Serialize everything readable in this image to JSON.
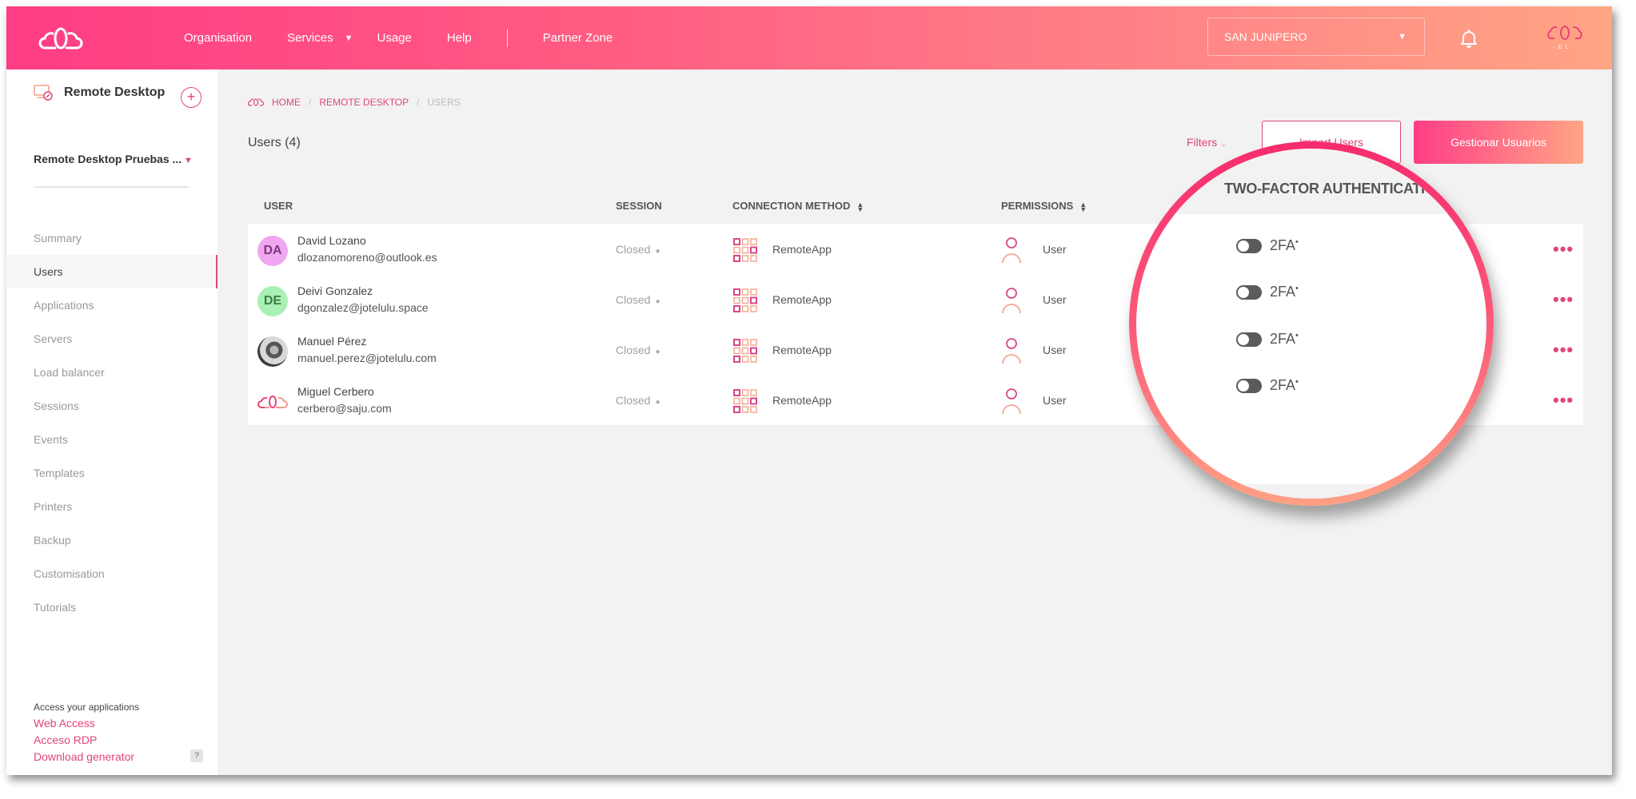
{
  "header": {
    "nav": {
      "organisation": "Organisation",
      "services": "Services",
      "usage": "Usage",
      "help": "Help",
      "partner_zone": "Partner Zone"
    },
    "org_selector": "SAN JUNIPERO",
    "icons": {
      "logo": "cloud-logo-icon",
      "bell": "bell-icon",
      "tenant_logo": "tenant-logo-icon"
    }
  },
  "sidebar": {
    "app_title": "Remote Desktop",
    "add_label": "+",
    "project": "Remote Desktop Pruebas ...",
    "menu": [
      {
        "label": "Summary",
        "active": false
      },
      {
        "label": "Users",
        "active": true
      },
      {
        "label": "Applications",
        "active": false
      },
      {
        "label": "Servers",
        "active": false
      },
      {
        "label": "Load balancer",
        "active": false
      },
      {
        "label": "Sessions",
        "active": false
      },
      {
        "label": "Events",
        "active": false
      },
      {
        "label": "Templates",
        "active": false
      },
      {
        "label": "Printers",
        "active": false
      },
      {
        "label": "Backup",
        "active": false
      },
      {
        "label": "Customisation",
        "active": false
      },
      {
        "label": "Tutorials",
        "active": false
      }
    ],
    "access": {
      "title": "Access your applications",
      "links": [
        "Web Access",
        "Acceso RDP",
        "Download generator"
      ],
      "help": "?"
    }
  },
  "breadcrumb": {
    "items": [
      "HOME",
      "REMOTE DESKTOP",
      "USERS"
    ],
    "separator": "/"
  },
  "toolbar": {
    "users_count": "Users (4)",
    "filters": "Filters",
    "filters_chevron": "⌄",
    "import_users": "Import Users",
    "manage_users": "Gestionar Usuarios"
  },
  "table": {
    "columns": {
      "user": "USER",
      "session": "SESSION",
      "connection_method": "CONNECTION METHOD",
      "permissions": "PERMISSIONS",
      "two_factor": "TWO-FACTOR AUTHENTICATION"
    },
    "sort_icon": "⬍",
    "rows": [
      {
        "initials": "DA",
        "avatar": "initials",
        "name": "David Lozano",
        "email": "dlozanomoreno@outlook.es",
        "session": "Closed",
        "connection": "RemoteApp",
        "permission": "User",
        "tfa_label": "2FA",
        "tfa_enabled": false,
        "more": "•••"
      },
      {
        "initials": "DE",
        "avatar": "initials",
        "name": "Deivi Gonzalez",
        "email": "dgonzalez@jotelulu.space",
        "session": "Closed",
        "connection": "RemoteApp",
        "permission": "User",
        "tfa_label": "2FA",
        "tfa_enabled": false,
        "more": "•••"
      },
      {
        "initials": "",
        "avatar": "photo",
        "name": "Manuel Pérez",
        "email": "manuel.perez@jotelulu.com",
        "session": "Closed",
        "connection": "RemoteApp",
        "permission": "User",
        "tfa_label": "2FA",
        "tfa_enabled": false,
        "more": "•••"
      },
      {
        "initials": "",
        "avatar": "logo",
        "name": "Miguel Cerbero",
        "email": "cerbero@saju.com",
        "session": "Closed",
        "connection": "RemoteApp",
        "permission": "User",
        "tfa_label": "2FA",
        "tfa_enabled": false,
        "more": "•••"
      }
    ]
  },
  "magnifier": {
    "title": "TWO-FACTOR AUTHENTICATIO",
    "tfa_label": "2FA",
    "tfa_mark": "•"
  },
  "colors": {
    "accent": "#e0457b",
    "header_gradient_start": "#ff3d85",
    "header_gradient_end": "#ffa584",
    "toggle_off": "#5b5b5b"
  }
}
